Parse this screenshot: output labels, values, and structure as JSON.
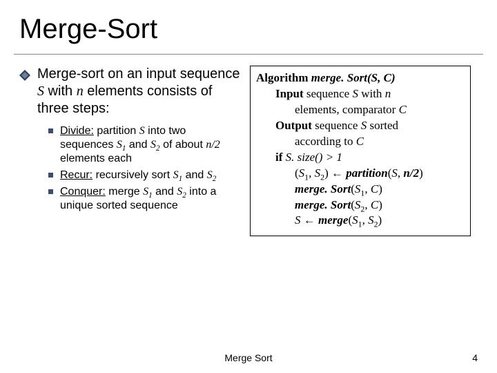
{
  "title": "Merge-Sort",
  "main_bullet": {
    "pre": "Merge-sort on an input sequence ",
    "S": "S",
    "mid1": " with ",
    "n": "n",
    "post": " elements consists of three steps:"
  },
  "sub": {
    "divide": {
      "label": "Divide:",
      "t1": " partition ",
      "S": "S",
      "t2": " into two sequences ",
      "S1": "S",
      "s1sub": "1",
      "and": " and ",
      "S2": "S",
      "s2sub": "2",
      "t3": " of about ",
      "nhalf": "n/2",
      "t4": " elements each"
    },
    "recur": {
      "label": "Recur:",
      "t1": " recursively sort ",
      "S1": "S",
      "s1sub": "1",
      "and": " and ",
      "S2": "S",
      "s2sub": "2"
    },
    "conquer": {
      "label": "Conquer:",
      "t1": " merge ",
      "S1": "S",
      "s1sub": "1",
      "and": " and ",
      "S2": "S",
      "s2sub": "2",
      "t2": " into a unique sorted sequence"
    }
  },
  "algo": {
    "l0_kw": "Algorithm",
    "l0_fn": " merge. Sort(S, C)",
    "l1_kw": "Input",
    "l1_a": " sequence ",
    "l1_S": "S",
    "l1_b": " with ",
    "l1_n": "n",
    "l1_c": "elements, comparator ",
    "l1_C": "C",
    "l2_kw": "Output",
    "l2_a": " sequence ",
    "l2_S": "S",
    "l2_b": " sorted",
    "l2_c": "according to ",
    "l2_C": "C",
    "l3_kw": "if ",
    "l3_body": "S. size() > 1",
    "l4_a": "(",
    "l4_S1": "S",
    "l4_s1": "1",
    "l4_b": ", ",
    "l4_S2": "S",
    "l4_s2": "2",
    "l4_c": ") ← ",
    "l4_fn": "partition",
    "l4_d": "(",
    "l4_Sp": "S",
    "l4_e": ", ",
    "l4_np": "n/2",
    "l4_f": ")",
    "l5_fn": "merge. Sort",
    "l5_a": "(",
    "l5_S1": "S",
    "l5_s1": "1",
    "l5_b": ", ",
    "l5_C": "C",
    "l5_c": ")",
    "l6_fn": "merge. Sort",
    "l6_a": "(",
    "l6_S2": "S",
    "l6_s2": "2",
    "l6_b": ", ",
    "l6_C": "C",
    "l6_c": ")",
    "l7_S": "S",
    "l7_a": " ← ",
    "l7_fn": "merge",
    "l7_b": "(",
    "l7_S1": "S",
    "l7_s1": "1",
    "l7_c": ", ",
    "l7_S2": "S",
    "l7_s2": "2",
    "l7_d": ")"
  },
  "footer_center": "Merge Sort",
  "footer_number": "4"
}
